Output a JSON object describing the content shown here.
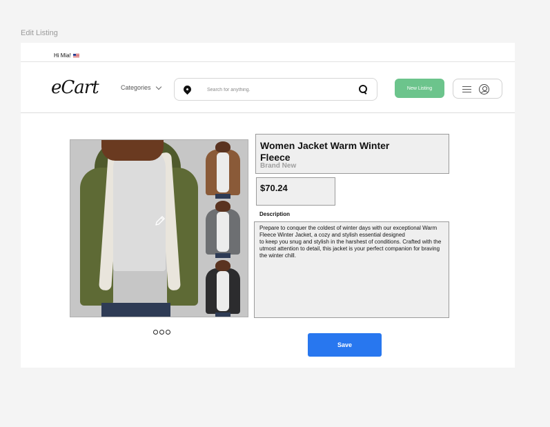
{
  "frame_label": "Edit Listing",
  "topbar": {
    "greeting": "Hi Mia!",
    "flag_icon": "us-flag-icon"
  },
  "header": {
    "logo": "eCart",
    "categories_label": "Categories",
    "search_placeholder": "Search for anything.",
    "new_listing_label": "New Listing"
  },
  "listing": {
    "title": "Women Jacket Warm Winter Fleece",
    "condition": "Brand New",
    "price": "$70.24",
    "description_label": "Description",
    "description": "Prepare to conquer the coldest of winter days with our exceptional Warm Fleece Winter Jacket, a cozy and stylish essential designed\n to keep you snug and stylish in the harshest of conditions. Crafted with the utmost attention to detail, this jacket is your perfect companion for braving the winter chill.",
    "image_dots": 3,
    "thumbnail_colors": [
      "#8a5a38",
      "#6d6f72",
      "#2c2c2e"
    ],
    "coat_color": "#5e6a35"
  },
  "actions": {
    "save_label": "Save"
  },
  "colors": {
    "accent": "#2877ef",
    "new_listing": "#6cc48c"
  }
}
